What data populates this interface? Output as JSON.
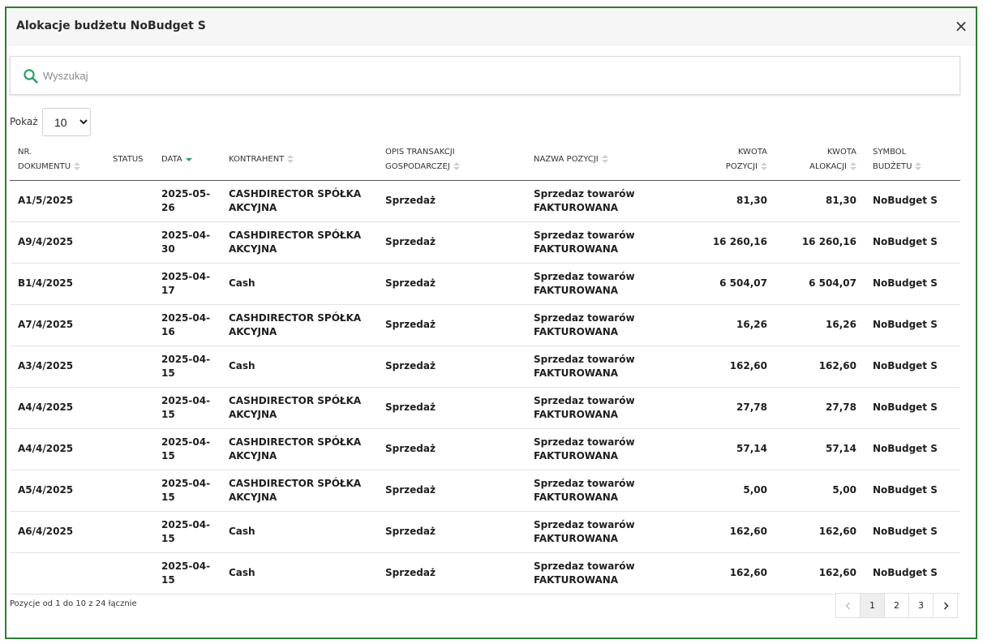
{
  "modal": {
    "title": "Alokacje budżetu NoBudget S",
    "close_glyph": "×"
  },
  "search": {
    "placeholder": "Wyszukaj",
    "value": ""
  },
  "length": {
    "label": "Pokaż",
    "selected": "10",
    "options": [
      "10"
    ]
  },
  "table": {
    "columns": [
      {
        "key": "doc",
        "label_lines": [
          "NR.",
          "DOKUMENTU"
        ],
        "sortable": true,
        "sort": "none",
        "align": "left"
      },
      {
        "key": "status",
        "label_lines": [
          "STATUS"
        ],
        "sortable": false,
        "sort": "none",
        "align": "left"
      },
      {
        "key": "date",
        "label_lines": [
          "DATA"
        ],
        "sortable": true,
        "sort": "desc",
        "align": "left"
      },
      {
        "key": "contractor",
        "label_lines": [
          "KONTRAHENT"
        ],
        "sortable": true,
        "sort": "none",
        "align": "left"
      },
      {
        "key": "desc",
        "label_lines": [
          "OPIS TRANSAKCJI",
          "GOSPODARCZEJ"
        ],
        "sortable": true,
        "sort": "none",
        "align": "left"
      },
      {
        "key": "item",
        "label_lines": [
          "NAZWA POZYCJI"
        ],
        "sortable": true,
        "sort": "none",
        "align": "left"
      },
      {
        "key": "amount_item",
        "label_lines": [
          "KWOTA",
          "POZYCJI"
        ],
        "sortable": true,
        "sort": "none",
        "align": "right"
      },
      {
        "key": "amount_alloc",
        "label_lines": [
          "KWOTA",
          "ALOKACJI"
        ],
        "sortable": true,
        "sort": "none",
        "align": "right"
      },
      {
        "key": "symbol",
        "label_lines": [
          "SYMBOL",
          "BUDŻETU"
        ],
        "sortable": true,
        "sort": "none",
        "align": "left"
      }
    ],
    "rows": [
      [
        "A1/5/2025",
        "",
        "2025-05-26",
        "CASHDIRECTOR SPÓŁKA AKCYJNA",
        "Sprzedaż",
        "Sprzedaz towarów FAKTUROWANA",
        "81,30",
        "81,30",
        "NoBudget S"
      ],
      [
        "A9/4/2025",
        "",
        "2025-04-30",
        "CASHDIRECTOR SPÓŁKA AKCYJNA",
        "Sprzedaż",
        "Sprzedaz towarów FAKTUROWANA",
        "16 260,16",
        "16 260,16",
        "NoBudget S"
      ],
      [
        "B1/4/2025",
        "",
        "2025-04-17",
        "Cash",
        "Sprzedaż",
        "Sprzedaz towarów FAKTUROWANA",
        "6 504,07",
        "6 504,07",
        "NoBudget S"
      ],
      [
        "A7/4/2025",
        "",
        "2025-04-16",
        "CASHDIRECTOR SPÓŁKA AKCYJNA",
        "Sprzedaż",
        "Sprzedaz towarów FAKTUROWANA",
        "16,26",
        "16,26",
        "NoBudget S"
      ],
      [
        "A3/4/2025",
        "",
        "2025-04-15",
        "Cash",
        "Sprzedaż",
        "Sprzedaz towarów FAKTUROWANA",
        "162,60",
        "162,60",
        "NoBudget S"
      ],
      [
        "A4/4/2025",
        "",
        "2025-04-15",
        "CASHDIRECTOR SPÓŁKA AKCYJNA",
        "Sprzedaż",
        "Sprzedaz towarów FAKTUROWANA",
        "27,78",
        "27,78",
        "NoBudget S"
      ],
      [
        "A4/4/2025",
        "",
        "2025-04-15",
        "CASHDIRECTOR SPÓŁKA AKCYJNA",
        "Sprzedaż",
        "Sprzedaz towarów FAKTUROWANA",
        "57,14",
        "57,14",
        "NoBudget S"
      ],
      [
        "A5/4/2025",
        "",
        "2025-04-15",
        "CASHDIRECTOR SPÓŁKA AKCYJNA",
        "Sprzedaż",
        "Sprzedaz towarów FAKTUROWANA",
        "5,00",
        "5,00",
        "NoBudget S"
      ],
      [
        "A6/4/2025",
        "",
        "2025-04-15",
        "Cash",
        "Sprzedaż",
        "Sprzedaz towarów FAKTUROWANA",
        "162,60",
        "162,60",
        "NoBudget S"
      ],
      [
        "",
        "",
        "2025-04-15",
        "Cash",
        "Sprzedaż",
        "Sprzedaz towarów FAKTUROWANA",
        "162,60",
        "162,60",
        "NoBudget S"
      ]
    ]
  },
  "footer": {
    "info": "Pozycje od 1 do 10 z 24 łącznie"
  },
  "pagination": {
    "prev_icon": "chevron-left-icon",
    "next_icon": "chevron-right-icon",
    "pages": [
      "1",
      "2",
      "3"
    ],
    "current": "1"
  },
  "colors": {
    "accent": "#2e9e6b",
    "border": "#2e7d32",
    "header_bg": "#f6f6f6"
  }
}
